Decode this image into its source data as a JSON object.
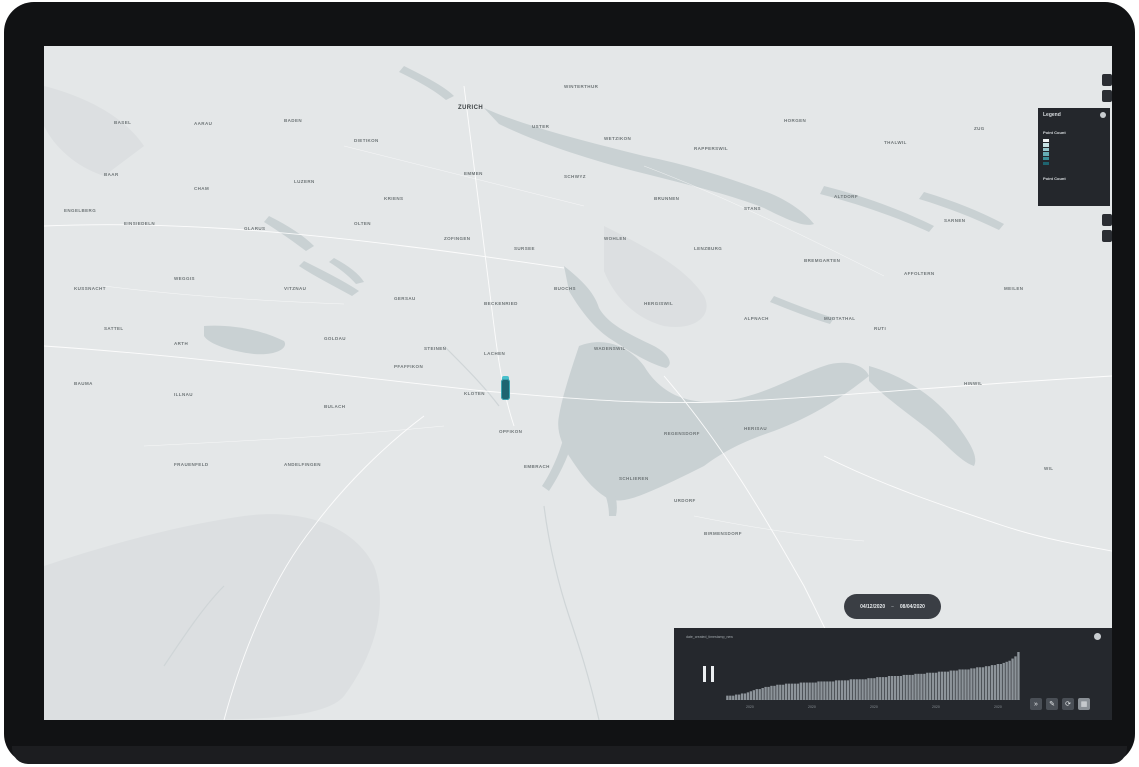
{
  "map": {
    "city_labels": [
      "ZURICH"
    ],
    "minor_place_labels": [
      "WINTERTHUR",
      "BASEL",
      "AARAU",
      "BADEN",
      "DIETIKON",
      "USTER",
      "WETZIKON",
      "RAPPERSWIL",
      "HORGEN",
      "THALWIL",
      "ZUG",
      "BAAR",
      "CHAM",
      "LUZERN",
      "KRIENS",
      "EMMEN",
      "SCHWYZ",
      "BRUNNEN",
      "STANS",
      "ALTDORF",
      "SARNEN",
      "ENGELBERG",
      "EINSIEDELN",
      "GLARUS",
      "OLTEN",
      "ZOFINGEN",
      "SURSEE",
      "WOHLEN",
      "LENZBURG",
      "BREMGARTEN",
      "AFFOLTERN",
      "MEILEN",
      "KUSSNACHT",
      "WEGGIS",
      "VITZNAU",
      "GERSAU",
      "BECKENRIED",
      "BUOCHS",
      "HERGISWIL",
      "ALPNACH",
      "MUOTATHAL",
      "SATTEL",
      "ARTH",
      "GOLDAU",
      "STEINEN",
      "LACHEN",
      "PFAFFIKON",
      "WADENSWIL",
      "RUTI",
      "HINWIL",
      "BAUMA",
      "ILLNAU",
      "BULACH",
      "KLOTEN",
      "OPFIKON",
      "REGENSDORF",
      "HERISAU",
      "WIL",
      "FRAUENFELD",
      "ANDELFINGEN",
      "EMBRACH",
      "SCHLIEREN",
      "URDORF",
      "BIRMENSDORF"
    ],
    "marker_color": "#1e6470",
    "water_color": "#c9d1d3",
    "land_color": "#e4e7e8"
  },
  "legend": {
    "title": "Legend",
    "layer_name": "Point Count",
    "layer_name_2": "Point Count",
    "color_scale": [
      "#f1f4f5",
      "#c6e0e2",
      "#98c8cd",
      "#66adb4",
      "#3a8f98",
      "#1e6470"
    ]
  },
  "date_range": {
    "start": "04/12/2020",
    "separator": "–",
    "end": "08/04/2020"
  },
  "timeline": {
    "field_label": "date_created_timestamp_new",
    "histogram_values": [
      4,
      4,
      4,
      5,
      5,
      6,
      6,
      7,
      8,
      9,
      10,
      10,
      11,
      12,
      12,
      13,
      13,
      14,
      14,
      14,
      15,
      15,
      15,
      15,
      15,
      16,
      16,
      16,
      16,
      16,
      16,
      17,
      17,
      17,
      17,
      17,
      17,
      18,
      18,
      18,
      18,
      18,
      19,
      19,
      19,
      19,
      19,
      19,
      20,
      20,
      20,
      21,
      21,
      21,
      21,
      22,
      22,
      22,
      22,
      22,
      23,
      23,
      23,
      23,
      24,
      24,
      24,
      24,
      25,
      25,
      25,
      25,
      26,
      26,
      26,
      26,
      27,
      27,
      27,
      28,
      28,
      28,
      28,
      29,
      29,
      30,
      30,
      30,
      31,
      31,
      32,
      32,
      33,
      33,
      34,
      35,
      36,
      38,
      40,
      44
    ],
    "axis_ticks": [
      "2020",
      "2020",
      "2020",
      "2020",
      "2020"
    ],
    "buttons": [
      "speed-button",
      "edit-button",
      "loop-button",
      "grid-button"
    ]
  }
}
